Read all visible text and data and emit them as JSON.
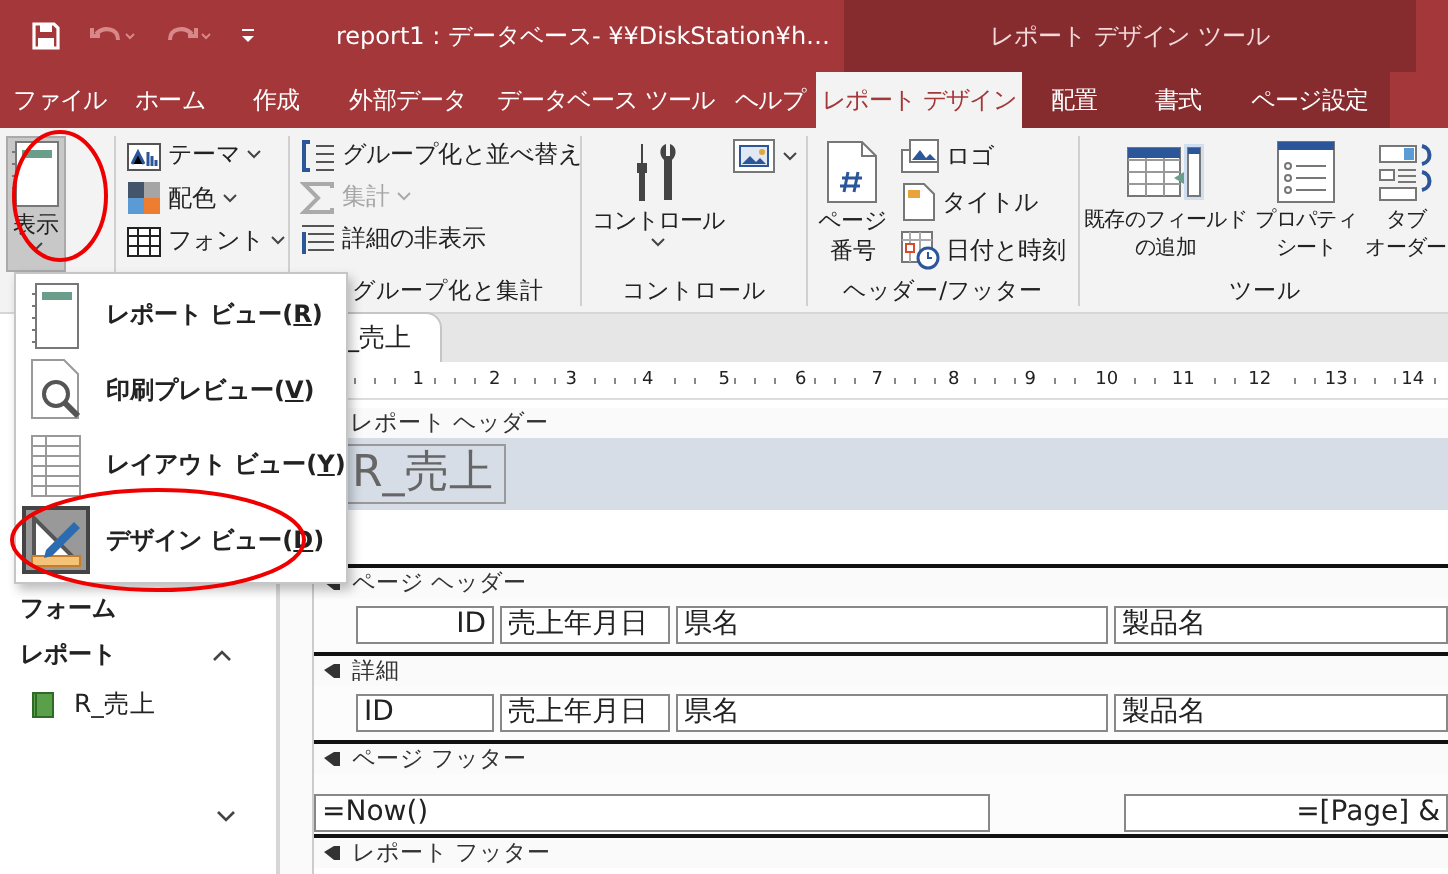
{
  "window": {
    "title": "report1 : データベース- ¥¥DiskStation¥h…",
    "context_title": "レポート デザイン ツール"
  },
  "tabs": [
    {
      "label": "ファイル",
      "selected": false,
      "contextual": false
    },
    {
      "label": "ホーム",
      "selected": false,
      "contextual": false
    },
    {
      "label": "作成",
      "selected": false,
      "contextual": false
    },
    {
      "label": "外部データ",
      "selected": false,
      "contextual": false
    },
    {
      "label": "データベース ツール",
      "selected": false,
      "contextual": false
    },
    {
      "label": "ヘルプ",
      "selected": false,
      "contextual": false
    },
    {
      "label": "レポート デザイン",
      "selected": true,
      "contextual": true
    },
    {
      "label": "配置",
      "selected": false,
      "contextual": true
    },
    {
      "label": "書式",
      "selected": false,
      "contextual": true
    },
    {
      "label": "ページ設定",
      "selected": false,
      "contextual": true
    }
  ],
  "ribbon": {
    "groups": [
      {
        "kind": "view",
        "buttons": [
          {
            "lines": [
              "表示"
            ],
            "menu": true,
            "disabled": false,
            "pressed": true
          }
        ]
      },
      {
        "kind": "themes",
        "buttons": [
          {
            "lines": [
              "テーマ"
            ],
            "menu": true,
            "disabled": false,
            "pressed": false
          },
          {
            "lines": [
              "配色"
            ],
            "menu": true,
            "disabled": false,
            "pressed": false
          },
          {
            "lines": [
              "フォント"
            ],
            "menu": true,
            "disabled": false,
            "pressed": false
          }
        ]
      },
      {
        "kind": "grouping",
        "label": "グループ化と集計",
        "buttons": [
          {
            "lines": [
              "グループ化と並べ替え"
            ],
            "menu": false,
            "disabled": false,
            "pressed": false
          },
          {
            "lines": [
              "集計"
            ],
            "menu": true,
            "disabled": true,
            "pressed": false
          },
          {
            "lines": [
              "詳細の非表示"
            ],
            "menu": false,
            "disabled": false,
            "pressed": false
          }
        ]
      },
      {
        "kind": "controls",
        "label": "コントロール",
        "buttons": [
          {
            "lines": [
              "コントロール"
            ],
            "menu": true,
            "disabled": false,
            "pressed": false
          },
          {
            "menu": true,
            "disabled": false,
            "pressed": false
          }
        ]
      },
      {
        "kind": "header_footer",
        "label": "ヘッダー/フッター",
        "buttons": [
          {
            "lines": [
              "ページ",
              "番号"
            ],
            "menu": false,
            "disabled": false,
            "pressed": false
          },
          {
            "lines": [
              "ロゴ"
            ],
            "menu": false,
            "disabled": false,
            "pressed": false
          },
          {
            "lines": [
              "タイトル"
            ],
            "menu": false,
            "disabled": false,
            "pressed": false
          },
          {
            "lines": [
              "日付と時刻"
            ],
            "menu": false,
            "disabled": false,
            "pressed": false
          }
        ]
      },
      {
        "kind": "tools",
        "label": "ツール",
        "buttons": [
          {
            "lines": [
              "既存のフィールド",
              "の追加"
            ],
            "menu": false,
            "disabled": false,
            "pressed": false
          },
          {
            "lines": [
              "プロパティ",
              "シート"
            ],
            "menu": false,
            "disabled": false,
            "pressed": false
          },
          {
            "lines": [
              "タブ",
              "オーダー"
            ],
            "menu": false,
            "disabled": false,
            "pressed": false
          }
        ]
      }
    ]
  },
  "view_menu": {
    "items": [
      {
        "before": "レポート ビュー(",
        "key": "R",
        "after": ")",
        "selected": false
      },
      {
        "before": "印刷プレビュー(",
        "key": "V",
        "after": ")",
        "selected": false
      },
      {
        "before": "レイアウト ビュー(",
        "key": "Y",
        "after": ")",
        "selected": false
      },
      {
        "before": "デザイン ビュー(",
        "key": "D",
        "after": ")",
        "selected": true
      }
    ]
  },
  "nav_pane": {
    "groups": [
      {
        "label": "フォーム"
      },
      {
        "label": "レポート",
        "expanded": true,
        "items": [
          {
            "label": "R_売上"
          }
        ]
      }
    ]
  },
  "document": {
    "tab": "_売上",
    "ruler": [
      "1",
      "2",
      "3",
      "4",
      "5",
      "6",
      "7",
      "8",
      "9",
      "10",
      "11",
      "12",
      "13",
      "14"
    ],
    "sections": [
      {
        "title": "レポート ヘッダー",
        "kind": "title",
        "controls": [
          {
            "text": "R_売上"
          }
        ]
      },
      {
        "title": "ページ ヘッダー",
        "kind": "fields",
        "controls": [
          {
            "text": "ID",
            "right_aligned": true
          },
          {
            "text": "売上年月日",
            "right_aligned": false
          },
          {
            "text": "県名",
            "right_aligned": false
          },
          {
            "text": "製品名",
            "right_aligned": false
          }
        ]
      },
      {
        "title": "詳細",
        "kind": "fields",
        "controls": [
          {
            "text": "ID",
            "right_aligned": false
          },
          {
            "text": "売上年月日",
            "right_aligned": false
          },
          {
            "text": "県名",
            "right_aligned": false
          },
          {
            "text": "製品名",
            "right_aligned": false
          }
        ]
      },
      {
        "title": "ページ フッター",
        "kind": "footer",
        "controls": [
          {
            "text": "=Now()",
            "right_aligned": false
          },
          {
            "text": "=[Page] &",
            "right_aligned": true
          }
        ]
      },
      {
        "title": "レポート フッター",
        "kind": "empty"
      }
    ]
  }
}
